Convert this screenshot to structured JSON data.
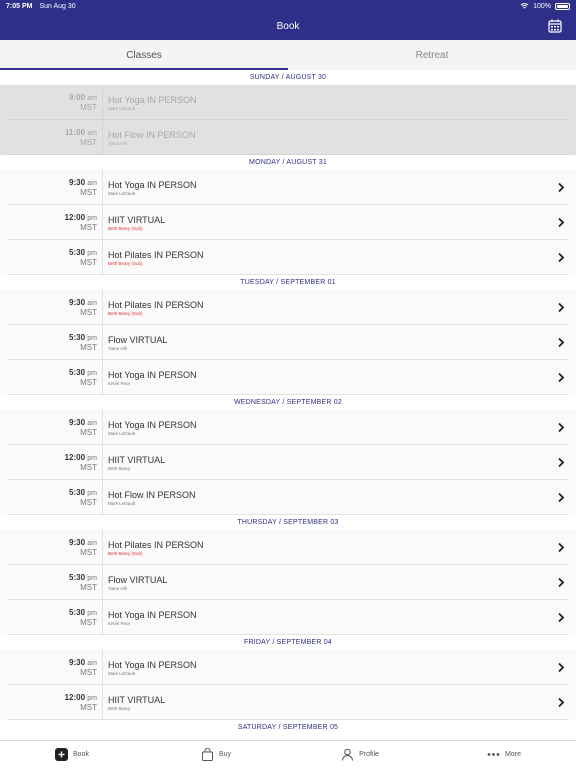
{
  "status": {
    "time": "7:05 PM",
    "date": "Sun Aug 30",
    "battery": "100%"
  },
  "nav": {
    "title": "Book"
  },
  "tabs": [
    "Classes",
    "Retreat"
  ],
  "days": [
    {
      "header": "SUNDAY / AUGUST 30",
      "classes": [
        {
          "time": "9:00",
          "ampm": "am",
          "tz": "MST",
          "name": "Hot Yoga IN PERSON",
          "teacher": "Mark LeGault",
          "sub": false,
          "disabled": true
        },
        {
          "time": "11:00",
          "ampm": "am",
          "tz": "MST",
          "name": "Hot Flow IN PERSON",
          "teacher": "Tiana Hill",
          "sub": false,
          "disabled": true
        }
      ]
    },
    {
      "header": "MONDAY / AUGUST 31",
      "classes": [
        {
          "time": "9:30",
          "ampm": "am",
          "tz": "MST",
          "name": "Hot Yoga IN PERSON",
          "teacher": "Mark LeGault",
          "sub": false,
          "disabled": false
        },
        {
          "time": "12:00",
          "ampm": "pm",
          "tz": "MST",
          "name": "HIIT VIRTUAL",
          "teacher": "Beth Beary (Sub)",
          "sub": true,
          "disabled": false
        },
        {
          "time": "5:30",
          "ampm": "pm",
          "tz": "MST",
          "name": "Hot Pilates IN PERSON",
          "teacher": "Beth Beary (Sub)",
          "sub": true,
          "disabled": false
        }
      ]
    },
    {
      "header": "TUESDAY / SEPTEMBER 01",
      "classes": [
        {
          "time": "9:30",
          "ampm": "am",
          "tz": "MST",
          "name": "Hot Pilates IN PERSON",
          "teacher": "Beth Beary (Sub)",
          "sub": true,
          "disabled": false
        },
        {
          "time": "5:30",
          "ampm": "pm",
          "tz": "MST",
          "name": "Flow VIRTUAL",
          "teacher": "Tiana Hill",
          "sub": false,
          "disabled": false
        },
        {
          "time": "5:30",
          "ampm": "pm",
          "tz": "MST",
          "name": "Hot Yoga IN PERSON",
          "teacher": "Kevin Prior",
          "sub": false,
          "disabled": false
        }
      ]
    },
    {
      "header": "WEDNESDAY / SEPTEMBER 02",
      "classes": [
        {
          "time": "9:30",
          "ampm": "am",
          "tz": "MST",
          "name": "Hot Yoga IN PERSON",
          "teacher": "Mark LeGault",
          "sub": false,
          "disabled": false
        },
        {
          "time": "12:00",
          "ampm": "pm",
          "tz": "MST",
          "name": "HIIT VIRTUAL",
          "teacher": "Beth Beary",
          "sub": false,
          "disabled": false
        },
        {
          "time": "5:30",
          "ampm": "pm",
          "tz": "MST",
          "name": "Hot Flow IN PERSON",
          "teacher": "Mark LeGault",
          "sub": false,
          "disabled": false
        }
      ]
    },
    {
      "header": "THURSDAY / SEPTEMBER 03",
      "classes": [
        {
          "time": "9:30",
          "ampm": "am",
          "tz": "MST",
          "name": "Hot Pilates IN PERSON",
          "teacher": "Beth Beary (Sub)",
          "sub": true,
          "disabled": false
        },
        {
          "time": "5:30",
          "ampm": "pm",
          "tz": "MST",
          "name": "Flow VIRTUAL",
          "teacher": "Tiana Hill",
          "sub": false,
          "disabled": false
        },
        {
          "time": "5:30",
          "ampm": "pm",
          "tz": "MST",
          "name": "Hot Yoga IN PERSON",
          "teacher": "Kevin Prior",
          "sub": false,
          "disabled": false
        }
      ]
    },
    {
      "header": "FRIDAY / SEPTEMBER 04",
      "classes": [
        {
          "time": "9:30",
          "ampm": "am",
          "tz": "MST",
          "name": "Hot Yoga IN PERSON",
          "teacher": "Mark LeGault",
          "sub": false,
          "disabled": false
        },
        {
          "time": "12:00",
          "ampm": "pm",
          "tz": "MST",
          "name": "HIIT VIRTUAL",
          "teacher": "Beth Beary",
          "sub": false,
          "disabled": false
        }
      ]
    },
    {
      "header": "SATURDAY / SEPTEMBER 05",
      "classes": []
    }
  ],
  "tabbar": [
    {
      "label": "Book",
      "icon": "book-plus-icon"
    },
    {
      "label": "Buy",
      "icon": "shopping-bag-icon"
    },
    {
      "label": "Profile",
      "icon": "person-icon"
    },
    {
      "label": "More",
      "icon": "more-dots-icon"
    }
  ],
  "colors": {
    "brand": "#2d2f88",
    "substitute": "#e0312d"
  }
}
